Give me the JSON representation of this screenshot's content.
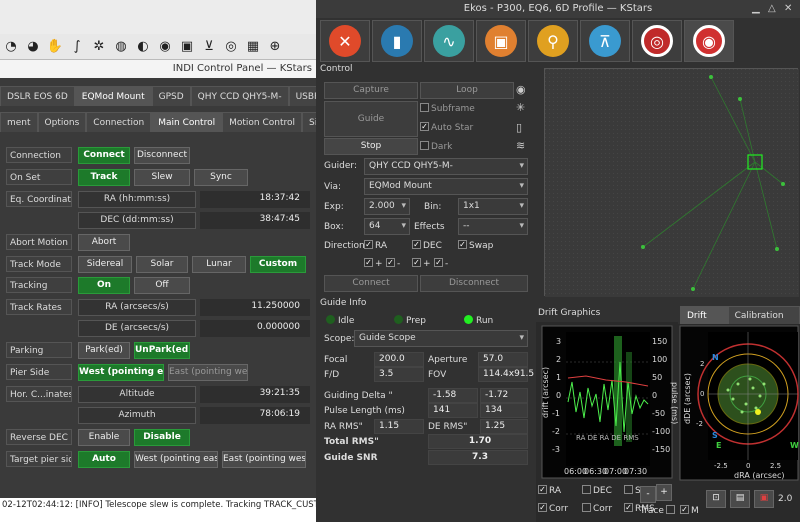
{
  "indi": {
    "title": "INDI Control Panel — KStars",
    "devices": [
      "DSLR EOS 6D",
      "EQMod Mount",
      "GPSD",
      "QHY CCD QHY5-M-",
      "USBFocus"
    ],
    "active_device_index": 1,
    "groups": [
      "ment",
      "Options",
      "Connection",
      "Main Control",
      "Motion Control",
      "Site M"
    ],
    "active_group_index": 3,
    "rows": {
      "connection": {
        "label": "Connection",
        "connect": "Connect",
        "disconnect": "Disconnect"
      },
      "on_set": {
        "label": "On Set",
        "track": "Track",
        "slew": "Slew",
        "sync": "Sync"
      },
      "eq": {
        "label": "Eq. Coordinates",
        "ra_label": "RA (hh:mm:ss)",
        "ra": "18:37:42",
        "dec_label": "DEC (dd:mm:ss)",
        "dec": "38:47:45"
      },
      "abort": {
        "label": "Abort Motion",
        "btn": "Abort"
      },
      "track_mode": {
        "label": "Track Mode",
        "sidereal": "Sidereal",
        "solar": "Solar",
        "lunar": "Lunar",
        "custom": "Custom"
      },
      "tracking": {
        "label": "Tracking",
        "on": "On",
        "off": "Off"
      },
      "track_rates": {
        "label": "Track Rates",
        "ra_label": "RA (arcsecs/s)",
        "ra": "11.250000",
        "de_label": "DE (arcsecs/s)",
        "de": "0.000000"
      },
      "parking": {
        "label": "Parking",
        "park": "Park(ed)",
        "unpark": "UnPark(ed)"
      },
      "pier_side": {
        "label": "Pier Side",
        "east": "West (pointing east)",
        "west": "East (pointing west)"
      },
      "hor": {
        "label": "Hor. C...inates",
        "alt_label": "Altitude",
        "alt": "39:21:35",
        "az_label": "Azimuth",
        "az": "78:06:19"
      },
      "reverse_dec": {
        "label": "Reverse DEC",
        "enable": "Enable",
        "disable": "Disable"
      },
      "target_pier": {
        "label": "Target pier side",
        "auto": "Auto",
        "east": "West (pointing east)",
        "west": "East (pointing west)"
      }
    },
    "log": "02-12T02:44:12: [INFO] Telescope slew is complete. Tracking TRACK_CUSTOM..."
  },
  "ekos": {
    "title": "Ekos - P300, EQ6, 6D Profile — KStars",
    "modules": [
      "setup-icon",
      "scheduler-icon",
      "analyze-icon",
      "capture-icon",
      "focus-icon",
      "mount-icon",
      "align-icon",
      "guide-icon"
    ],
    "control_label": "Control",
    "capture": "Capture",
    "loop": "Loop",
    "guide": "Guide",
    "stop": "Stop",
    "subframe": "Subframe",
    "auto_star": "Auto Star",
    "dark": "Dark",
    "guider_label": "Guider:",
    "guider": "QHY CCD QHY5-M-",
    "via_label": "Via:",
    "via": "EQMod Mount",
    "exp_label": "Exp:",
    "exp": "2.000",
    "bin_label": "Bin:",
    "bin": "1x1",
    "box_label": "Box:",
    "box": "64",
    "effects_label": "Effects",
    "effects": "--",
    "directions_label": "Directions",
    "ra": "RA",
    "dec": "DEC",
    "swap": "Swap",
    "plus": "+",
    "minus": "-",
    "connect": "Connect",
    "disconnect": "Disconnect",
    "guide_info_label": "Guide Info",
    "status": {
      "idle": "Idle",
      "prep": "Prep",
      "run": "Run"
    },
    "scope_label": "Scope:",
    "scope": "Guide Scope",
    "focal_label": "Focal",
    "focal": "200.0",
    "aperture_label": "Aperture",
    "aperture": "57.0",
    "fd_label": "F/D",
    "fd": "3.5",
    "fov_label": "FOV",
    "fov": "114.4x91.5",
    "guiding_delta_label": "Guiding Delta \"",
    "delta_ra": "-1.58",
    "delta_de": "-1.72",
    "pulse_label": "Pulse Length (ms)",
    "pulse_ra": "141",
    "pulse_de": "134",
    "ra_rms_label": "RA RMS\"",
    "ra_rms": "1.15",
    "de_rms_label": "DE RMS\"",
    "de_rms": "1.25",
    "total_rms_label": "Total RMS\"",
    "total_rms": "1.70",
    "snr_label": "Guide SNR",
    "snr": "7.3",
    "drift_graphics_label": "Drift Graphics",
    "drift_plot_tab": "Drift Plot",
    "calib_plot_tab": "Calibration Plot",
    "drift_y_left": "drift (arcsec)",
    "drift_y_right": "pulse (ms)",
    "drift_x_ticks": [
      "06:00",
      "06:30",
      "07:00",
      "07:30"
    ],
    "drift_left_ticks": [
      "3",
      "2",
      "1",
      "0",
      "-1",
      "-2",
      "-3"
    ],
    "drift_right_ticks": [
      "150",
      "100",
      "50",
      "0",
      "-50",
      "-100",
      "-150"
    ],
    "drift_legend": [
      "RA",
      "DE",
      "RA",
      "DE",
      "RMS"
    ],
    "plot_ylabel": "dDE (arcsec)",
    "plot_xlabel": "dRA (arcsec)",
    "plot_x_ticks": [
      "-2.5",
      "0",
      "2.5"
    ],
    "plot_y_ticks": [
      "2",
      "0",
      "-2"
    ],
    "compass": {
      "n": "N",
      "e": "E",
      "s": "S",
      "w": "W"
    },
    "check_ra": "RA",
    "check_dec": "DEC",
    "check_snr": "SNR",
    "check_corr": "Corr",
    "check_corr2": "Corr",
    "check_rms": "RMS",
    "check_trace": "Trace",
    "check_m": "M",
    "zoom_value": "2.0",
    "colors": {
      "ra": "#4caf50",
      "de": "#ff4040",
      "accent": "#22cc22"
    }
  }
}
